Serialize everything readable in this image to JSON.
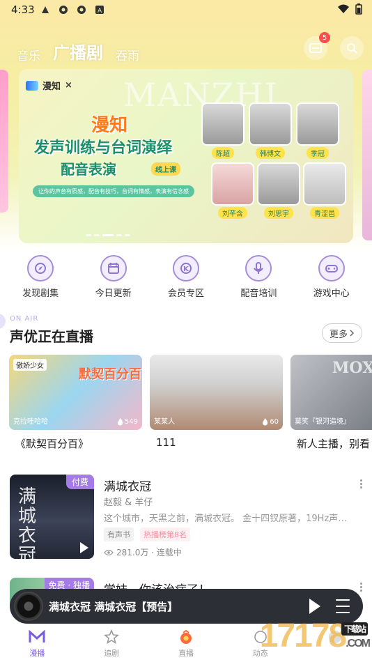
{
  "status_bar": {
    "time": "4:33"
  },
  "top_nav": {
    "tabs": [
      {
        "label": "音乐"
      },
      {
        "label": "广播剧",
        "active": true
      },
      {
        "label": "吞雨"
      }
    ],
    "message_badge": "5"
  },
  "banner": {
    "brand": "漫知",
    "brand_cross": "×",
    "watermark": "MANZHI",
    "title_line1": "漫知",
    "title_line2": "发声训练与台词演绎",
    "title_line3": "配音表演",
    "tag": "线上课",
    "subtitle": "让你的声音有质感，配音有技巧，台词有情感，表演有信念感",
    "people": [
      {
        "name": "陈超"
      },
      {
        "name": "韩博文"
      },
      {
        "name": "季冠"
      },
      {
        "name": "刘芊含"
      },
      {
        "name": "刘思宇"
      },
      {
        "name": "青涩邑"
      }
    ],
    "active_dot": 3
  },
  "quick_entries": [
    {
      "label": "发现剧集",
      "icon": "discover-icon"
    },
    {
      "label": "今日更新",
      "icon": "calendar-icon"
    },
    {
      "label": "会员专区",
      "icon": "vip-icon"
    },
    {
      "label": "配音培训",
      "icon": "mic-icon"
    },
    {
      "label": "游戏中心",
      "icon": "gamepad-icon"
    }
  ],
  "live_section": {
    "kicker": "ON AIR",
    "title": "声优正在直播",
    "more_label": "更多",
    "cards": [
      {
        "title": "《默契百分百》",
        "tag": "傲娇少女",
        "host": "克拉哇哈哈",
        "count": "549",
        "overlay": "默契百分百"
      },
      {
        "title": "111",
        "host": "某某人",
        "count": "60"
      },
      {
        "title": "新人主播，别看",
        "host": "莫笑『银河造境』",
        "overlay": "MOXI"
      }
    ]
  },
  "list_items": [
    {
      "badge": "付费",
      "cover_text": "满城衣冠",
      "title": "满城衣冠",
      "author": "赵毅 & 羊仔",
      "desc": "这个城市，天黑之前，满城衣冠。 金十四钗原著，19Hz声…",
      "chips": [
        "有声书",
        "热播榜第8名"
      ],
      "views": "281.0万 · 连载中"
    },
    {
      "badge": "免费 · 独播",
      "title": "学妹，你该治病了！"
    }
  ],
  "mini_player": {
    "title": "满城衣冠 满城衣冠【预告】"
  },
  "bottom_nav": [
    {
      "label": "漫播",
      "active": true
    },
    {
      "label": "追剧"
    },
    {
      "label": "直播"
    },
    {
      "label": "动态"
    }
  ],
  "watermark": {
    "text": "17178",
    "sub": "下载站",
    "domain": ".COM"
  },
  "colors": {
    "accent": "#7b5be0",
    "paid": "#a57be8",
    "player_bg": "#2d2f36"
  }
}
